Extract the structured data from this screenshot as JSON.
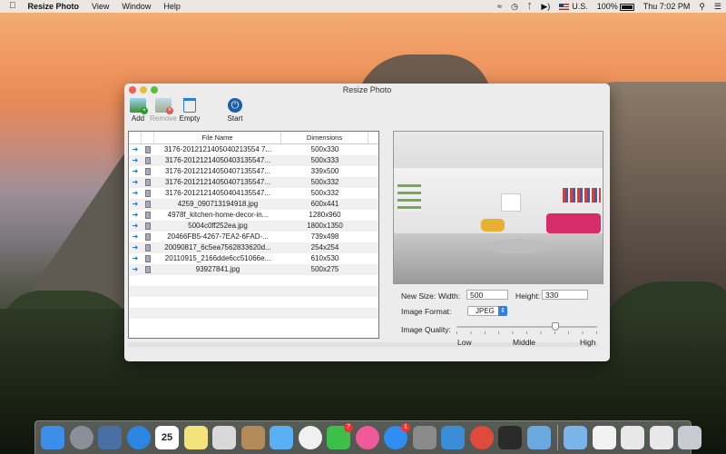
{
  "menubar": {
    "apple_icon": "apple-icon",
    "app_name": "Resize Photo",
    "menus": [
      "View",
      "Window",
      "Help"
    ],
    "language": "U.S.",
    "battery": "100%",
    "clock": "Thu 7:02 PM",
    "status_icons": [
      "wifi-icon",
      "time-machine-icon",
      "bluetooth-icon",
      "volume-icon",
      "flag-icon",
      "battery-icon",
      "search-icon",
      "list-icon"
    ]
  },
  "window": {
    "title": "Resize Photo",
    "toolbar": {
      "add_label": "Add",
      "remove_label": "Remove",
      "empty_label": "Empty",
      "start_label": "Start"
    },
    "table": {
      "col_name": "File Name",
      "col_dimensions": "Dimensions",
      "rows": [
        {
          "name": "3176-2012121405040213554 7...",
          "dim": "500x330"
        },
        {
          "name": "3176-20121214050403135547...",
          "dim": "500x333"
        },
        {
          "name": "3176-20121214050407135547...",
          "dim": "339x500"
        },
        {
          "name": "3176-20121214050407135547...",
          "dim": "500x332"
        },
        {
          "name": "3176-20121214050404135547...",
          "dim": "500x332"
        },
        {
          "name": "4259_090713194918.jpg",
          "dim": "600x441"
        },
        {
          "name": "4978f_kitchen-home-decor-in...",
          "dim": "1280x960"
        },
        {
          "name": "5004c0ff252ea.jpg",
          "dim": "1800x1350"
        },
        {
          "name": "20466FB5-4267-7EA2-6FAD-...",
          "dim": "739x498"
        },
        {
          "name": "20090817_6c5ea7562833620d...",
          "dim": "254x254"
        },
        {
          "name": "20110915_2166dde6cc51066e...",
          "dim": "610x530"
        },
        {
          "name": "93927841.jpg",
          "dim": "500x275"
        }
      ]
    },
    "settings": {
      "new_size_label": "New Size:",
      "width_label": "Width:",
      "width_value": "500",
      "height_label": "Height:",
      "height_value": "330",
      "format_label": "Image Format:",
      "format_value": "JPEG",
      "quality_label": "Image Quality:",
      "quality_low": "Low",
      "quality_middle": "Middle",
      "quality_high": "High",
      "quality_level": 0.7
    }
  },
  "dock": {
    "calendar_day": "25",
    "facetime_badge": "7",
    "appstore_badge": "1",
    "apps": [
      {
        "name": "finder-icon",
        "color": "#3d8ee8"
      },
      {
        "name": "launchpad-icon",
        "color": "#8a8f99"
      },
      {
        "name": "photo-icon",
        "color": "#4a6fa5"
      },
      {
        "name": "safari-icon",
        "color": "#2a86e0"
      },
      {
        "name": "calendar-icon",
        "color": "#ffffff"
      },
      {
        "name": "notes-icon",
        "color": "#f4e27a"
      },
      {
        "name": "preview-icon",
        "color": "#d9d9d9"
      },
      {
        "name": "contacts-icon",
        "color": "#b58a5a"
      },
      {
        "name": "messages-icon",
        "color": "#5ab0f5"
      },
      {
        "name": "photos-icon",
        "color": "#f0f0f0"
      },
      {
        "name": "facetime-icon",
        "color": "#3cc04a"
      },
      {
        "name": "itunes-icon",
        "color": "#f05a9a"
      },
      {
        "name": "appstore-icon",
        "color": "#2f8ef0"
      },
      {
        "name": "system-preferences-icon",
        "color": "#8a8a8a"
      },
      {
        "name": "xcode-icon",
        "color": "#3a8ed8"
      },
      {
        "name": "chrome-icon",
        "color": "#e04a3a"
      },
      {
        "name": "unity-icon",
        "color": "#2a2a2a"
      },
      {
        "name": "resize-photo-icon",
        "color": "#6aa8e0"
      },
      {
        "name": "folder-icon",
        "color": "#7ab4e8"
      },
      {
        "name": "document-icon",
        "color": "#f2f2f2"
      },
      {
        "name": "screenshot-icon",
        "color": "#e8e8e8"
      },
      {
        "name": "screenshot2-icon",
        "color": "#e8e8e8"
      },
      {
        "name": "trash-icon",
        "color": "#c8ccd2"
      }
    ]
  }
}
